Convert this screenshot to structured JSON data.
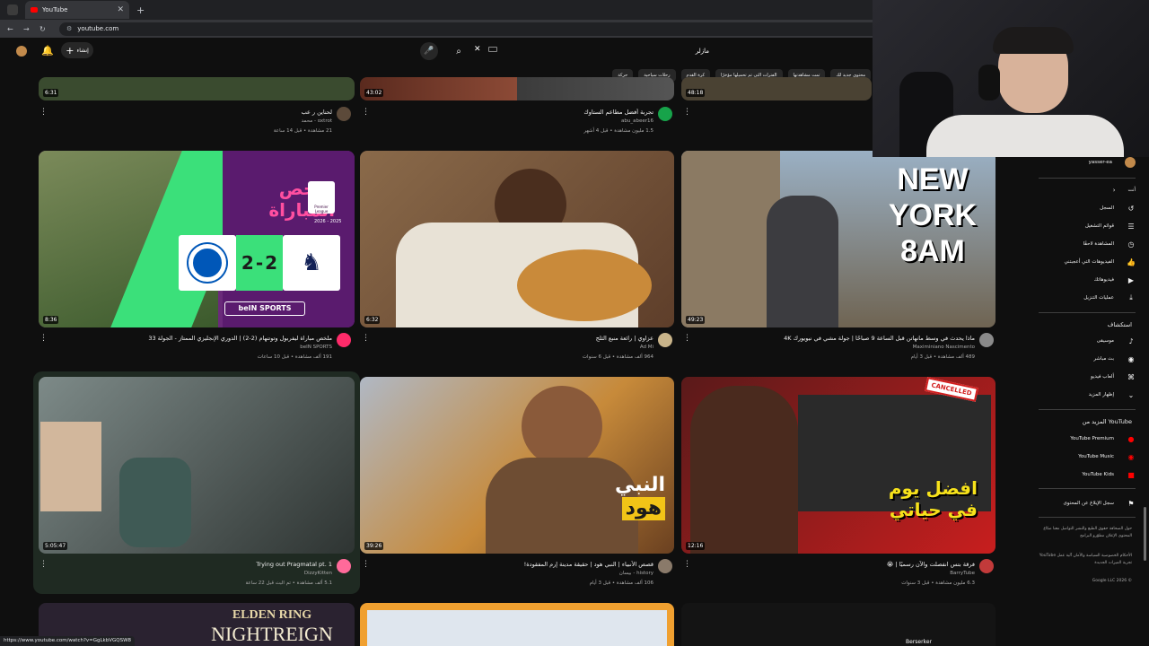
{
  "browser": {
    "tab_title": "YouTube",
    "url": "youtube.com",
    "status_url": "https://www.youtube.com/watch?v=GgLkbVGQSW8"
  },
  "header": {
    "create_label": "إنشاء",
    "search_value": "مازلر"
  },
  "chips": [
    "محتوى جديد لك",
    "تمت مشاهدتها",
    "الفترات التي تم تحميلها مؤخرًا",
    "كرة القدم",
    "رحلات سياحية",
    "حركة"
  ],
  "top_row": [
    {
      "title": "لحناين ر عب",
      "channel": "oxtrot - محمد",
      "meta": "21 مشاهدة • قبل 14 ساعة",
      "duration": "6:31"
    },
    {
      "title": "تجربة أفضل مطاعم الستاوك",
      "channel": "abu_abeer16",
      "meta": "1.5 مليون مشاهدة • قبل 4 أشهر",
      "duration": "43:02"
    },
    {
      "title": "",
      "channel": "",
      "meta": "",
      "duration": "48:18"
    }
  ],
  "videos": [
    {
      "title": "ملخص مباراة ليفربول وتوتنهام (2-2) | الدوري الإنجليزي الممتاز - الجولة 33",
      "channel": "beIN SPORTS",
      "meta": "191 ألف مشاهدة • قبل 10 ساعات",
      "duration": "8:36"
    },
    {
      "title": "عزاوي | رائعة منبع الثلج",
      "channel": "Ad Mi",
      "meta": "964 ألف مشاهدة • قبل 6 سنوات",
      "duration": "6:32"
    },
    {
      "title": "ماذا يحدث في وسط مانهاتن قبل الساعة 9 صباحًا | جولة مشي في نيويورك 4K",
      "channel": "Maximiniano Nascimento",
      "meta": "489 ألف مشاهدة • قبل 3 أيام",
      "duration": "49:23"
    },
    {
      "title": "Trying out Pragmatal pt. 1",
      "channel": "DizzyKitten",
      "meta": "5.1 ألف مشاهدة • تم البث قبل 22 ساعة",
      "duration": "5:05:47"
    },
    {
      "title": "قصص الأنبياء | النبي هود | حقيقة مدينة إرم المفقودة!",
      "channel": "history - بيسان",
      "meta": "106 ألف مشاهدة • قبل 3 أيام",
      "duration": "39:26"
    },
    {
      "title": "فرقة بتس انفصلت والآن رسميًا | 😭",
      "channel": "BarryTube",
      "meta": "6.3 مليون مشاهدة • قبل 3 سنوات",
      "duration": "12:16"
    }
  ],
  "thumb_text": {
    "summary_title": "ملخص المباراة",
    "score_home": "2",
    "score_away": "2",
    "season": "2026 - 2025",
    "premier_league": "Premier League",
    "bein": "beIN SPORTS",
    "new_york": [
      "NEW",
      "YORK",
      "8AM"
    ],
    "prophet": [
      "النبي",
      "هود"
    ],
    "best_day": [
      "افضل يوم",
      "في حياتي"
    ],
    "cancelled": "CANCELLED",
    "elden_ring": "ELDEN RING",
    "nightreign": "NIGHTREIGN",
    "berserker": "Berserker"
  },
  "sidebar": {
    "user": "yasser-ea",
    "you_label": "أنت",
    "you_items": [
      {
        "label": "السجل",
        "icon": "history-icon",
        "glyph": "↺"
      },
      {
        "label": "قوائم التشغيل",
        "icon": "playlist-icon",
        "glyph": "☰"
      },
      {
        "label": "المشاهدة لاحقًا",
        "icon": "watch-later-icon",
        "glyph": "◷"
      },
      {
        "label": "الفيديوهات التي أعجبتني",
        "icon": "like-icon",
        "glyph": "👍"
      },
      {
        "label": "فيديوهاتك",
        "icon": "your-videos-icon",
        "glyph": "▶"
      },
      {
        "label": "عمليات التنزيل",
        "icon": "download-icon",
        "glyph": "⤓"
      }
    ],
    "explore_label": "استكشاف",
    "explore_items": [
      {
        "label": "موسيقى",
        "icon": "music-icon",
        "glyph": "♪"
      },
      {
        "label": "بث مباشر",
        "icon": "live-icon",
        "glyph": "◉"
      },
      {
        "label": "ألعاب فيديو",
        "icon": "gaming-icon",
        "glyph": "⌘"
      },
      {
        "label": "إظهار المزيد",
        "icon": "chevron-down-icon",
        "glyph": "⌄"
      }
    ],
    "more_label": "المزيد من YouTube",
    "more_items": [
      {
        "label": "YouTube Premium",
        "icon": "premium-icon"
      },
      {
        "label": "YouTube Music",
        "icon": "yt-music-icon"
      },
      {
        "label": "YouTube Kids",
        "icon": "yt-kids-icon"
      }
    ],
    "report_label": "سجل الإبلاغ عن المحتوى",
    "footer1": "حول   الصحافة   حقوق الطبع والنشر   التواصل معنا   صنّاع المحتوى   الإعلان   مطوّرو البرامج",
    "footer2": "الأحكام   الخصوصية   السياسة والأمان   آلية عمل YouTube   تجربة الميزات الجديدة",
    "copyright": "© 2026 Google LLC"
  },
  "colors": {
    "background": "#0f0f0f",
    "accent": "#ff0000",
    "text": "#f1f1f1",
    "secondary": "#aaaaaa"
  }
}
